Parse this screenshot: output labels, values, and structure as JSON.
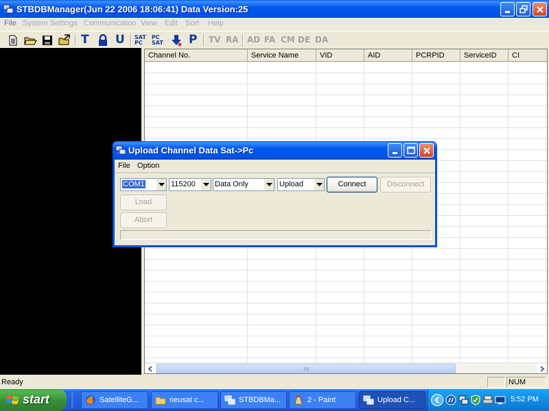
{
  "window": {
    "title": "STBDBManager(Jun 22 2006 18:06:41)  Data Version:25"
  },
  "menu": [
    "File",
    "System Settings",
    "Communication",
    "View",
    "Edit",
    "Sort",
    "Help"
  ],
  "toolbar": {
    "text_buttons": [
      "TV",
      "RA",
      "AD",
      "FA",
      "CM",
      "DE",
      "DA"
    ],
    "sat_pc_label": "SAT PC",
    "pc_sat_label": "PC SAT",
    "p_label": "P",
    "t_label": "T",
    "u_label": "U"
  },
  "grid": {
    "columns": [
      "Channel No.",
      "Service Name",
      "VID",
      "AID",
      "PCRPID",
      "ServiceID",
      "CI"
    ]
  },
  "dialog": {
    "title": "Upload Channel Data Sat->Pc",
    "menu": [
      "File",
      "Option"
    ],
    "port": "COM1",
    "baud": "115200",
    "data_mode": "Data Only",
    "direction": "Upload",
    "connect_label": "Connect",
    "disconnect_label": "Disconnect",
    "load_label": "Load",
    "abort_label": "Abort"
  },
  "status": {
    "text": "Ready",
    "num": "NUM"
  },
  "taskbar": {
    "start_label": "start",
    "tasks": [
      "SatelliteG...",
      "neusat c...",
      "STBDBMa...",
      "2 - Paint",
      "Upload C..."
    ],
    "clock": "5:52 PM"
  }
}
